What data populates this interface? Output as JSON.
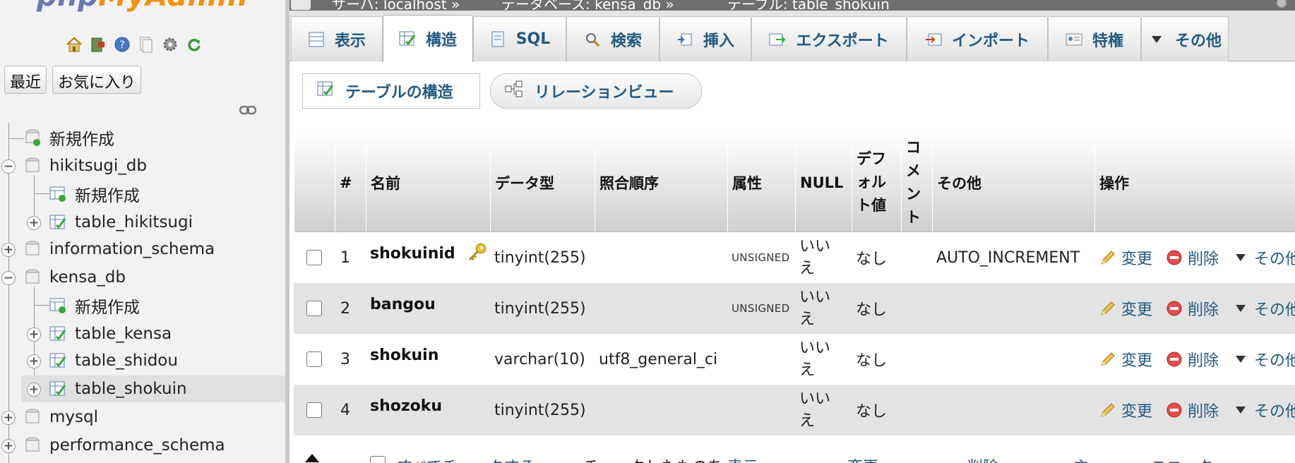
{
  "sidebar": {
    "logo_php": "php",
    "logo_admin": "MyAdmin",
    "quick_icons": [
      "home-icon",
      "exit-icon",
      "help-icon",
      "docs-icon",
      "settings-icon",
      "reload-icon"
    ],
    "tabs": {
      "recent": "最近",
      "favorites": "お気に入り"
    },
    "tree": {
      "new1": "新規作成",
      "db_hikitsugi": "hikitsugi_db",
      "new2": "新規作成",
      "table_hikitsugi": "table_hikitsugi",
      "db_info": "information_schema",
      "db_kensa": "kensa_db",
      "new3": "新規作成",
      "table_kensa": "table_kensa",
      "table_shidou": "table_shidou",
      "table_shokuin": "table_shokuin",
      "db_mysql": "mysql",
      "db_perf": "performance_schema"
    }
  },
  "topbar": {
    "server": "サーバ: localhost »",
    "database": "データベース: kensa_db »",
    "table": "テーブル: table_shokuin"
  },
  "tabs": {
    "browse": "表示",
    "structure": "構造",
    "sql": "SQL",
    "search": "検索",
    "insert": "挿入",
    "export": "エクスポート",
    "import": "インポート",
    "privileges": "特権",
    "more": "その他"
  },
  "subnav": {
    "table_structure": "テーブルの構造",
    "relation_view": "リレーションビュー"
  },
  "table": {
    "headers": {
      "num": "#",
      "name": "名前",
      "type": "データ型",
      "collation": "照合順序",
      "attributes": "属性",
      "null": "NULL",
      "default_l1": "デフ",
      "default_l2": "ォル",
      "default_l3": "ト値",
      "comment_l1": "コ",
      "comment_l2": "メ",
      "comment_l3": "ン",
      "comment_l4": "ト",
      "extra": "その他",
      "action": "操作"
    },
    "rows": [
      {
        "num": "1",
        "name": "shokuinid",
        "type": "tinyint(255)",
        "collation": "",
        "attributes": "UNSIGNED",
        "null_l1": "いい",
        "null_l2": "え",
        "default": "なし",
        "extra": "AUTO_INCREMENT",
        "change": "変更",
        "drop": "削除",
        "more": "その他"
      },
      {
        "num": "2",
        "name": "bangou",
        "type": "tinyint(255)",
        "collation": "",
        "attributes": "UNSIGNED",
        "null_l1": "いい",
        "null_l2": "え",
        "default": "なし",
        "extra": "",
        "change": "変更",
        "drop": "削除",
        "more": "その他"
      },
      {
        "num": "3",
        "name": "shokuin",
        "type": "varchar(10)",
        "collation": "utf8_general_ci",
        "attributes": "",
        "null_l1": "いい",
        "null_l2": "え",
        "default": "なし",
        "extra": "",
        "change": "変更",
        "drop": "削除",
        "more": "その他"
      },
      {
        "num": "4",
        "name": "shozoku",
        "type": "tinyint(255)",
        "collation": "",
        "attributes": "",
        "null_l1": "いい",
        "null_l2": "え",
        "default": "なし",
        "extra": "",
        "change": "変更",
        "drop": "削除",
        "more": "その他"
      }
    ]
  },
  "bottom": {
    "check_all": "すべてチェックする",
    "with_selected": "チェックしたものを:",
    "browse": "表示",
    "change": "変更",
    "drop": "削除",
    "primary": "主",
    "unique": "ユニーク"
  },
  "colors": {
    "link": "#235a81",
    "php": "#6c78af",
    "admin": "#f29111",
    "row_alt": "#e3e3e3"
  }
}
